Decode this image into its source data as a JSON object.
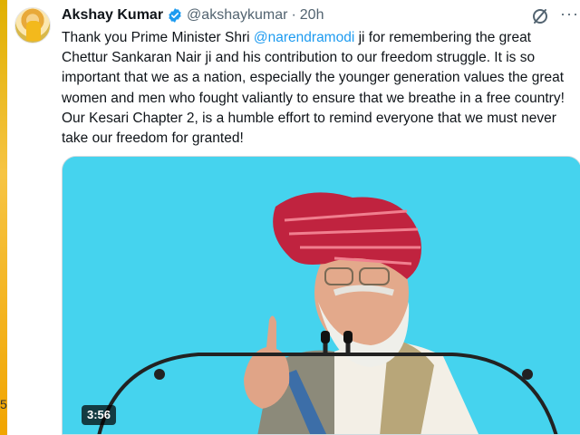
{
  "tweet": {
    "author_name": "Akshay Kumar",
    "handle": "@akshaykumar",
    "separator": "·",
    "time": "20h",
    "text_before": "Thank you Prime Minister Shri ",
    "mention": "@narendramodi",
    "text_after": " ji for remembering the great Chettur Sankaran Nair ji and his contribution to our freedom struggle. It is so important that we as a nation, especially the younger generation values the great women and men who fought valiantly to ensure that we breathe in a free country! Our Kesari Chapter 2, is a humble effort to remind everyone that we must never take our freedom for granted!",
    "video_duration": "3:56",
    "left_edge_mark": "5"
  },
  "icons": {
    "verified": "verified-badge-icon",
    "grok": "grok-icon",
    "more": "more-options-icon"
  },
  "colors": {
    "mention": "#1d9bf0",
    "verified": "#1d9bf0",
    "secondary_text": "#536471",
    "video_background": "#45d3ee"
  }
}
